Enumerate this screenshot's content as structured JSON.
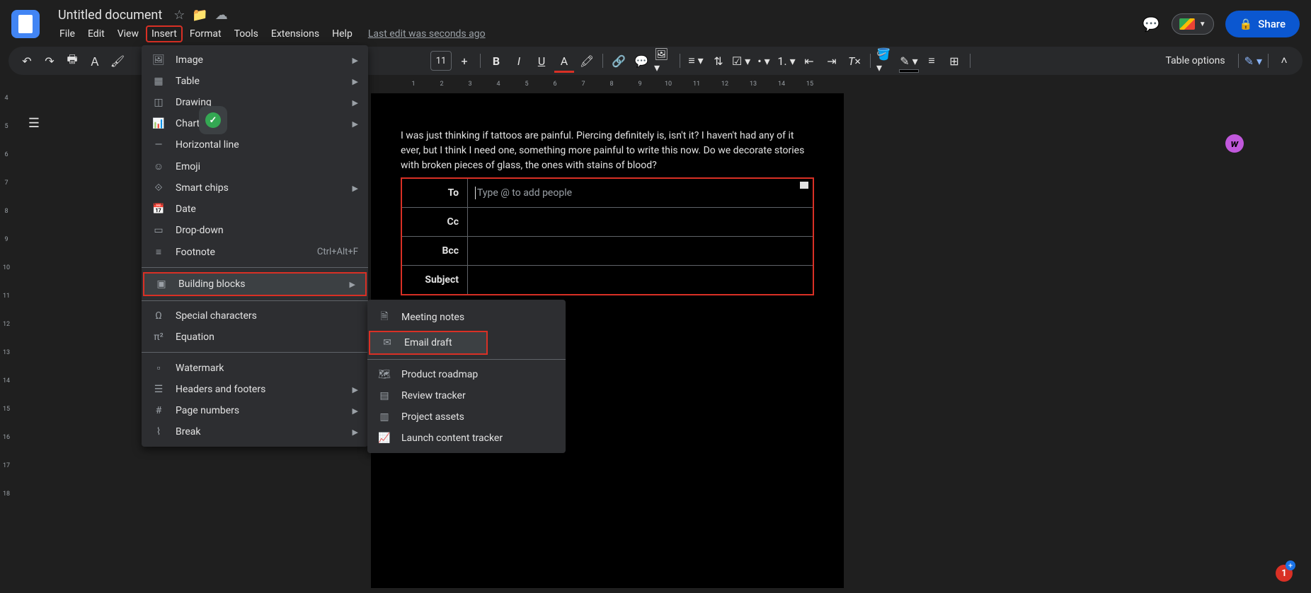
{
  "header": {
    "doc_title": "Untitled document",
    "last_edit": "Last edit was seconds ago",
    "share_label": "Share"
  },
  "menubar": {
    "items": [
      {
        "label": "File"
      },
      {
        "label": "Edit"
      },
      {
        "label": "View"
      },
      {
        "label": "Insert",
        "active": true
      },
      {
        "label": "Format"
      },
      {
        "label": "Tools"
      },
      {
        "label": "Extensions"
      },
      {
        "label": "Help"
      }
    ]
  },
  "toolbar": {
    "zoom": "1",
    "font_size": "11",
    "table_options": "Table options"
  },
  "h_ruler": [
    "1",
    "2",
    "3",
    "4",
    "5",
    "6",
    "7",
    "8",
    "9",
    "10",
    "11",
    "12",
    "13",
    "14",
    "15"
  ],
  "v_ruler": [
    "4",
    "5",
    "6",
    "7",
    "8",
    "9",
    "10",
    "11",
    "12",
    "13",
    "14",
    "15",
    "16",
    "17",
    "18"
  ],
  "document": {
    "body_text": "I was just thinking if tattoos are painful. Piercing definitely is, isn't it? I haven't had any of it ever, but I think I need one, something more painful to write this now. Do we decorate stories with broken pieces of glass, the ones with stains of blood?",
    "email_draft": {
      "to_label": "To",
      "to_placeholder": "Type @ to add people",
      "cc_label": "Cc",
      "bcc_label": "Bcc",
      "subject_label": "Subject"
    }
  },
  "insert_menu": {
    "items": [
      {
        "icon": "🖼",
        "label": "Image",
        "has_sub": true
      },
      {
        "icon": "▦",
        "label": "Table",
        "has_sub": true
      },
      {
        "icon": "◫",
        "label": "Drawing",
        "has_sub": true
      },
      {
        "icon": "📊",
        "label": "Chart",
        "has_sub": true
      },
      {
        "icon": "—",
        "label": "Horizontal line"
      },
      {
        "icon": "☺",
        "label": "Emoji"
      },
      {
        "icon": "⟐",
        "label": "Smart chips",
        "has_sub": true
      },
      {
        "icon": "📅",
        "label": "Date"
      },
      {
        "icon": "▭",
        "label": "Drop-down"
      },
      {
        "icon": "≡",
        "label": "Footnote",
        "shortcut": "Ctrl+Alt+F"
      },
      {
        "sep": true
      },
      {
        "icon": "▣",
        "label": "Building blocks",
        "has_sub": true,
        "highlighted": true
      },
      {
        "sep": true
      },
      {
        "icon": "Ω",
        "label": "Special characters"
      },
      {
        "icon": "π²",
        "label": "Equation"
      },
      {
        "sep": true
      },
      {
        "icon": "▫",
        "label": "Watermark"
      },
      {
        "icon": "☰",
        "label": "Headers and footers",
        "has_sub": true
      },
      {
        "icon": "#",
        "label": "Page numbers",
        "has_sub": true
      },
      {
        "icon": "⌇",
        "label": "Break",
        "has_sub": true
      }
    ]
  },
  "building_blocks_submenu": {
    "items": [
      {
        "icon": "🗎",
        "label": "Meeting notes"
      },
      {
        "icon": "✉",
        "label": "Email draft",
        "highlighted": true
      },
      {
        "sep": true
      },
      {
        "icon": "🗺",
        "label": "Product roadmap"
      },
      {
        "icon": "▤",
        "label": "Review tracker"
      },
      {
        "icon": "▥",
        "label": "Project assets"
      },
      {
        "icon": "📈",
        "label": "Launch content tracker"
      }
    ]
  },
  "badges": {
    "user_initial": "w",
    "notif_count": "1"
  }
}
